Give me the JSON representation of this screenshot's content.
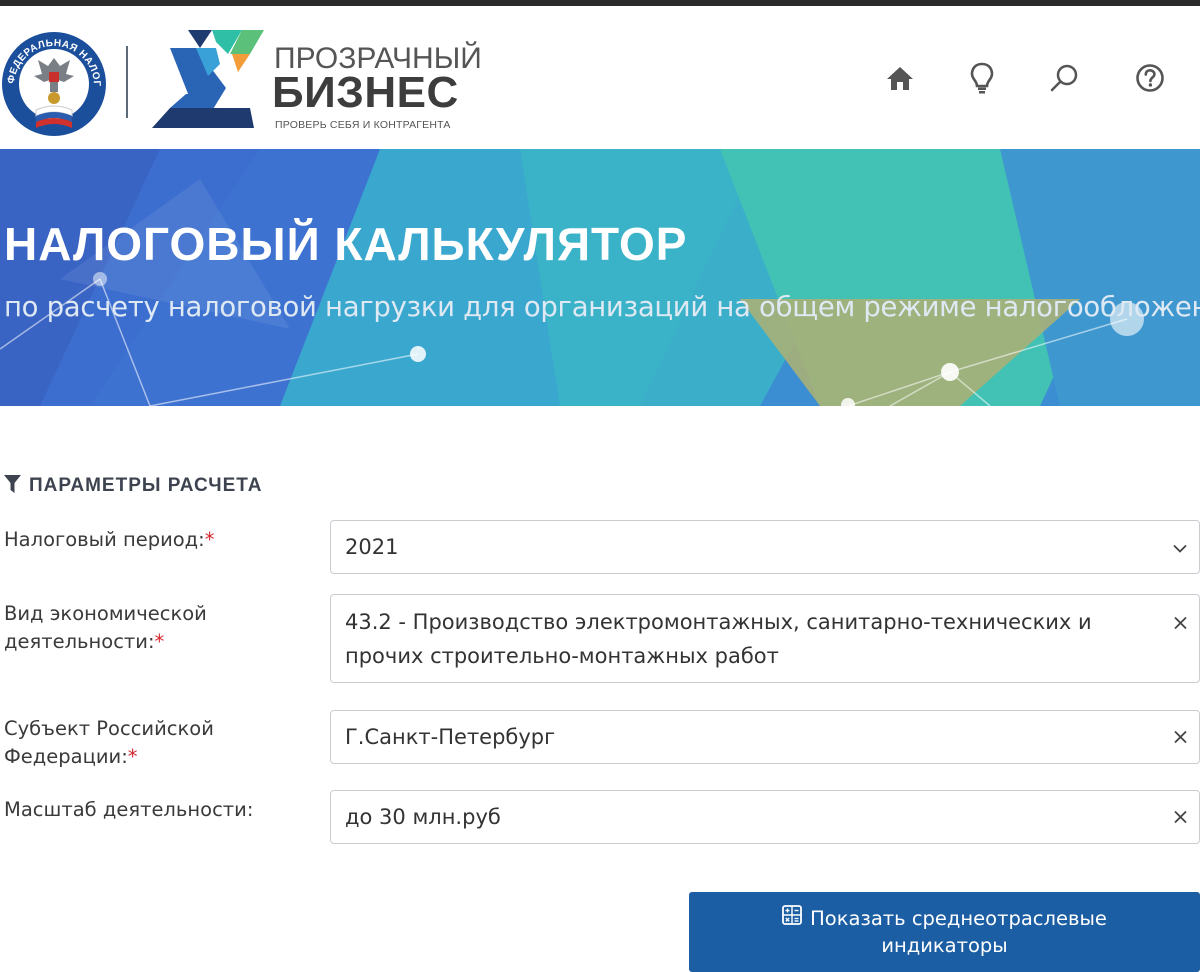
{
  "header": {
    "emblem_text": "ФЕДЕРАЛЬНАЯ НАЛОГОВАЯ СЛУЖБА",
    "logo_title_line1": "ПРОЗРАЧНЫЙ",
    "logo_title_line2": "БИЗНЕС",
    "logo_tagline": "ПРОВЕРЬ СЕБЯ И КОНТРАГЕНТА",
    "nav_icons": [
      "home-icon",
      "lightbulb-icon",
      "search-icon",
      "help-icon"
    ]
  },
  "banner": {
    "title": "НАЛОГОВЫЙ КАЛЬКУЛЯТОР",
    "subtitle": "по расчету налоговой нагрузки для организаций на общем режиме налогообложения"
  },
  "params": {
    "section_title": "ПАРАМЕТРЫ РАСЧЕТА",
    "fields": [
      {
        "label": "Налоговый период:",
        "required": "*",
        "value": "2021",
        "control": "chevron-down-icon"
      },
      {
        "label_line1": "Вид экономической",
        "label_line2": "деятельности:",
        "required": "*",
        "value_line1": "43.2 - Производство электромонтажных, санитарно-технических и",
        "value_line2": "прочих строительно-монтажных работ",
        "control": "clear-icon"
      },
      {
        "label_line1": "Субъект Российской",
        "label_line2": "Федерации:",
        "required": "*",
        "value": "Г.Санкт-Петербург",
        "control": "clear-icon"
      },
      {
        "label": "Масштаб деятельности:",
        "value": "до 30 млн.руб",
        "control": "clear-icon"
      }
    ]
  },
  "actions": {
    "show_button_line1": "Показать среднеотраслевые",
    "show_button_line2": "индикаторы"
  },
  "colors": {
    "primary_button": "#1c5ea3",
    "required": "#d4262e",
    "banner_blue": "#3a8fd0",
    "banner_teal": "#3fc0b8"
  }
}
